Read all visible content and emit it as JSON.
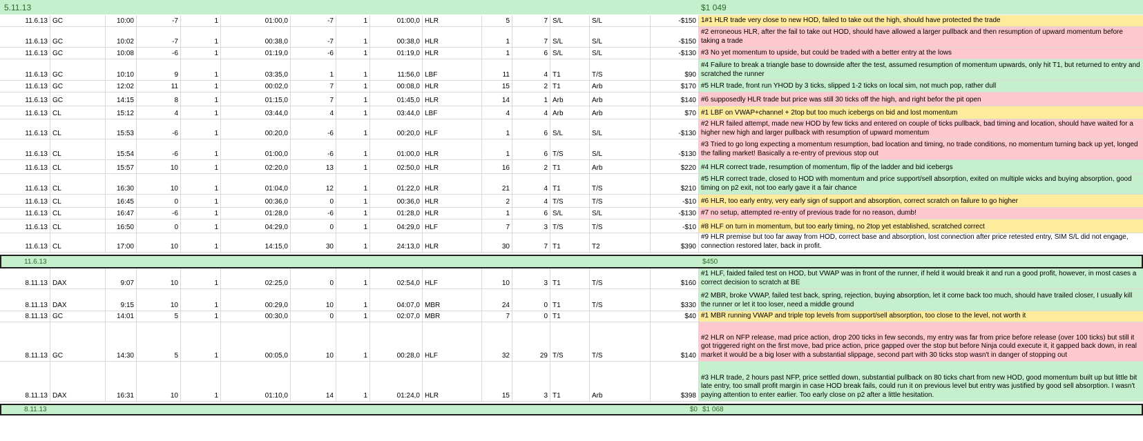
{
  "header": {
    "date": "5.11.13",
    "total": "$1 049"
  },
  "block1": [
    {
      "date": "11.6.13",
      "sym": "GC",
      "time": "10:00",
      "a": "-7",
      "b": "1",
      "d1": "01:00,0",
      "c": "-7",
      "e": "1",
      "d2": "01:00,0",
      "setup": "HLR",
      "f": "5",
      "g": "7",
      "x1": "S/L",
      "x2": "S/L",
      "pl": "-$150",
      "note": "1#1 HLR trade very close to new HOD, failed to take out the high, should have protected the trade",
      "color": "y"
    },
    {
      "date": "11.6.13",
      "sym": "GC",
      "time": "10:02",
      "a": "-7",
      "b": "1",
      "d1": "00:38,0",
      "c": "-7",
      "e": "1",
      "d2": "00:38,0",
      "setup": "HLR",
      "f": "1",
      "g": "7",
      "x1": "S/L",
      "x2": "S/L",
      "pl": "-$150",
      "note": "#2 erroneous HLR, after the fail to take out HOD, should have allowed a larger pullback and then resumption of upward momentum before taking a trade",
      "color": "p"
    },
    {
      "date": "11.6.13",
      "sym": "GC",
      "time": "10:08",
      "a": "-6",
      "b": "1",
      "d1": "01:19,0",
      "c": "-6",
      "e": "1",
      "d2": "01:19,0",
      "setup": "HLR",
      "f": "1",
      "g": "6",
      "x1": "S/L",
      "x2": "S/L",
      "pl": "-$130",
      "note": "#3 No yet momentum to upside, but could be traded with a better entry at the lows",
      "color": "p"
    },
    {
      "date": "11.6.13",
      "sym": "GC",
      "time": "10:10",
      "a": "9",
      "b": "1",
      "d1": "03:35,0",
      "c": "1",
      "e": "1",
      "d2": "11:56,0",
      "setup": "LBF",
      "f": "11",
      "g": "4",
      "x1": "T1",
      "x2": "T/S",
      "pl": "$90",
      "note": "#4 Failure to break a triangle base to downside after the test, assumed resumption of momentum upwards, only hit T1, but returned to entry and scratched the runner",
      "color": "g"
    },
    {
      "date": "11.6.13",
      "sym": "GC",
      "time": "12:02",
      "a": "11",
      "b": "1",
      "d1": "00:02,0",
      "c": "7",
      "e": "1",
      "d2": "00:08,0",
      "setup": "HLR",
      "f": "15",
      "g": "2",
      "x1": "T1",
      "x2": "Arb",
      "pl": "$170",
      "note": "#5 HLR trade, front run YHOD by 3 ticks, slipped 1-2 ticks on local sim, not much pop, rather dull",
      "color": "g"
    },
    {
      "date": "11.6.13",
      "sym": "GC",
      "time": "14:15",
      "a": "8",
      "b": "1",
      "d1": "01:15,0",
      "c": "7",
      "e": "1",
      "d2": "01:45,0",
      "setup": "HLR",
      "f": "14",
      "g": "1",
      "x1": "Arb",
      "x2": "Arb",
      "pl": "$140",
      "note": "#6 supposedly HLR trade but price was still 30 ticks off the high, and right befor the pit open",
      "color": "p"
    },
    {
      "date": "11.6.13",
      "sym": "CL",
      "time": "15:12",
      "a": "4",
      "b": "1",
      "d1": "03:44,0",
      "c": "4",
      "e": "1",
      "d2": "03:44,0",
      "setup": "LBF",
      "f": "4",
      "g": "4",
      "x1": "Arb",
      "x2": "Arb",
      "pl": "$70",
      "note": "#1 LBF on VWAP+channel + 2top but too much icebergs on bid and lost momentum",
      "color": "y"
    },
    {
      "date": "11.6.13",
      "sym": "CL",
      "time": "15:53",
      "a": "-6",
      "b": "1",
      "d1": "00:20,0",
      "c": "-6",
      "e": "1",
      "d2": "00:20,0",
      "setup": "HLF",
      "f": "1",
      "g": "6",
      "x1": "S/L",
      "x2": "S/L",
      "pl": "-$130",
      "note": "#2 HLR failed attempt, made new HOD by few ticks and entered on couple of ticks pullback, bad timing and location, should have waited for a higher new high and larger pullback with resumption of upward momentum",
      "color": "p"
    },
    {
      "date": "11.6.13",
      "sym": "CL",
      "time": "15:54",
      "a": "-6",
      "b": "1",
      "d1": "01:00,0",
      "c": "-6",
      "e": "1",
      "d2": "01:00,0",
      "setup": "HLR",
      "f": "1",
      "g": "6",
      "x1": "T/S",
      "x2": "S/L",
      "pl": "-$130",
      "note": "#3 Tried to go long expecting a momentum resumption, bad location and timing, no trade conditions, no momentum turning back up yet, longed the falling market! Basically a re-entry of previous stop out",
      "color": "p"
    },
    {
      "date": "11.6.13",
      "sym": "CL",
      "time": "15:57",
      "a": "10",
      "b": "1",
      "d1": "02:20,0",
      "c": "13",
      "e": "1",
      "d2": "02:50,0",
      "setup": "HLR",
      "f": "16",
      "g": "2",
      "x1": "T1",
      "x2": "Arb",
      "pl": "$220",
      "note": "#4 HLR correct trade, resumption of momentum, flip of the ladder and bid icebergs",
      "color": "g"
    },
    {
      "date": "11.6.13",
      "sym": "CL",
      "time": "16:30",
      "a": "10",
      "b": "1",
      "d1": "01:04,0",
      "c": "12",
      "e": "1",
      "d2": "01:22,0",
      "setup": "HLR",
      "f": "21",
      "g": "4",
      "x1": "T1",
      "x2": "T/S",
      "pl": "$210",
      "note": "#5 HLR correct trade, closed to HOD with momentum and price support/sell absorption, exited on multiple wicks and buying absorption, good timing on p2 exit, not too early gave it a fair chance",
      "color": "g"
    },
    {
      "date": "11.6.13",
      "sym": "CL",
      "time": "16:45",
      "a": "0",
      "b": "1",
      "d1": "00:36,0",
      "c": "0",
      "e": "1",
      "d2": "00:36,0",
      "setup": "HLR",
      "f": "2",
      "g": "4",
      "x1": "T/S",
      "x2": "T/S",
      "pl": "-$10",
      "note": "#6 HLR, too early entry, very early sign of support and absorption, correct scratch on failure to go higher",
      "color": "y"
    },
    {
      "date": "11.6.13",
      "sym": "CL",
      "time": "16:47",
      "a": "-6",
      "b": "1",
      "d1": "01:28,0",
      "c": "-6",
      "e": "1",
      "d2": "01:28,0",
      "setup": "HLR",
      "f": "1",
      "g": "6",
      "x1": "S/L",
      "x2": "S/L",
      "pl": "-$130",
      "note": "#7 no setup, attempted re-entry of previous trade for no reason, dumb!",
      "color": "p"
    },
    {
      "date": "11.6.13",
      "sym": "CL",
      "time": "16:50",
      "a": "0",
      "b": "1",
      "d1": "04:29,0",
      "c": "0",
      "e": "1",
      "d2": "04:29,0",
      "setup": "HLF",
      "f": "7",
      "g": "3",
      "x1": "T/S",
      "x2": "T/S",
      "pl": "-$10",
      "note": "#8 HLF on turn in momentum, but too early timing, no 2top yet established, scratched correct",
      "color": "y"
    },
    {
      "date": "11.6.13",
      "sym": "CL",
      "time": "17:00",
      "a": "10",
      "b": "1",
      "d1": "14:15,0",
      "c": "30",
      "e": "1",
      "d2": "24:13,0",
      "setup": "HLR",
      "f": "30",
      "g": "7",
      "x1": "T1",
      "x2": "T2",
      "pl": "$390",
      "note": "#9 HLR premise but too far away from HOD, correct base and absorption, lost connection after price retested entry, SIM S/L did not engage, connection restored later, back in profit.",
      "color": "w"
    }
  ],
  "summary1": {
    "date": "11.6.13",
    "total": "$450"
  },
  "block2": [
    {
      "date": "8.11.13",
      "sym": "DAX",
      "time": "9:07",
      "a": "10",
      "b": "1",
      "d1": "02:25,0",
      "c": "0",
      "e": "1",
      "d2": "02:54,0",
      "setup": "HLF",
      "f": "10",
      "g": "3",
      "x1": "T1",
      "x2": "T/S",
      "pl": "$160",
      "note": "#1 HLF, faided failed test on HOD, but VWAP was in front of the runner, if held it would break it and run a good profit, however, in most cases a correct decision to scratch at BE",
      "color": "g"
    },
    {
      "date": "8.11.13",
      "sym": "DAX",
      "time": "9:15",
      "a": "10",
      "b": "1",
      "d1": "00:29,0",
      "c": "10",
      "e": "1",
      "d2": "04:07,0",
      "setup": "MBR",
      "f": "24",
      "g": "0",
      "x1": "T1",
      "x2": "T/S",
      "pl": "$330",
      "note": "#2 MBR, broke VWAP, failed test back, spring, rejection, buying absorption, let it come back too much, should have trailed closer, I usually kill the runner or let it too loser, need a middle ground",
      "color": "g"
    },
    {
      "date": "8.11.13",
      "sym": "GC",
      "time": "14:01",
      "a": "5",
      "b": "1",
      "d1": "00:30,0",
      "c": "0",
      "e": "1",
      "d2": "02:07,0",
      "setup": "MBR",
      "f": "7",
      "g": "0",
      "x1": "T1",
      "x2": "",
      "pl": "$40",
      "note": "#1 MBR running VWAP and triple top levels from support/sell absorption, too close to the level, not worth it",
      "color": "y"
    },
    {
      "date": "8.11.13",
      "sym": "GC",
      "time": "14:30",
      "a": "5",
      "b": "1",
      "d1": "00:05,0",
      "c": "10",
      "e": "1",
      "d2": "00:28,0",
      "setup": "HLF",
      "f": "32",
      "g": "29",
      "x1": "T/S",
      "x2": "T/S",
      "pl": "$140",
      "note": "#2 HLR on NFP release, mad price action, drop 200 ticks in few seconds, my entry was far from price before release (over 100 ticks) but still it got triggered right on the first move, bad price action, price gapped over the stop but before Ninja could execute it, it gapped back down, in real market it would be a big loser with a substantial slippage, second part with 30 ticks stop wasn't in danger of stopping out",
      "color": "p"
    },
    {
      "date": "8.11.13",
      "sym": "DAX",
      "time": "16:31",
      "a": "10",
      "b": "1",
      "d1": "01:10,0",
      "c": "14",
      "e": "1",
      "d2": "01:24,0",
      "setup": "HLR",
      "f": "15",
      "g": "3",
      "x1": "T1",
      "x2": "Arb",
      "pl": "$398",
      "note": "#3 HLR trade, 2 hours past NFP, price settled down, substantial pullback on 80 ticks chart from new HOD, good momentum built up but little bit late entry, too small profit margin in case HOD break fails, could run it on previous level but entry was justified by good sell absorption. I wasn't paying attention to enter earlier. Too early close on p2 after a little hesitation.",
      "color": "g"
    }
  ],
  "summary2": {
    "date": "8.11.13",
    "total": "$0",
    "running": "$1 068"
  }
}
